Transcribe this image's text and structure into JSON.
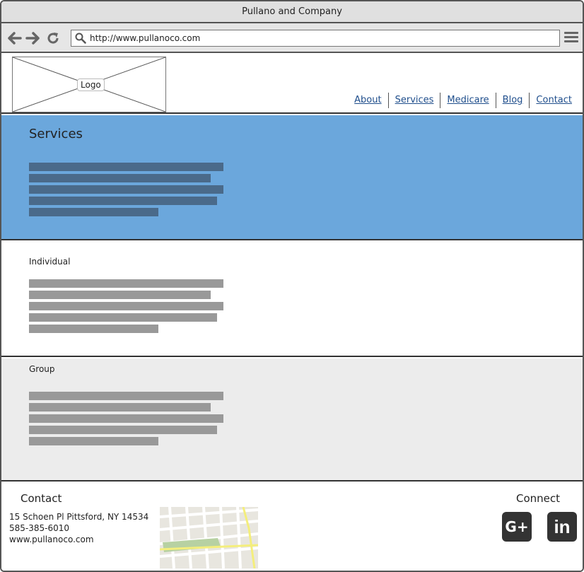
{
  "browser": {
    "window_title": "Pullano and Company",
    "url": "http://www.pullanoco.com",
    "icons": [
      "back-arrow-icon",
      "forward-arrow-icon",
      "reload-icon",
      "search-icon",
      "hamburger-menu-icon"
    ]
  },
  "header": {
    "logo_label": "Logo",
    "nav": [
      {
        "label": "About"
      },
      {
        "label": "Services"
      },
      {
        "label": "Medicare"
      },
      {
        "label": "Blog"
      },
      {
        "label": "Contact"
      }
    ]
  },
  "services": {
    "title": "Services",
    "color": "#6ba7dc"
  },
  "individual": {
    "title": "Individual"
  },
  "group": {
    "title": "Group"
  },
  "footer": {
    "contact_title": "Contact",
    "address": "15 Schoen Pl Pittsford, NY 14534",
    "phone": "585-385-6010",
    "website": "www.pullanoco.com",
    "connect_title": "Connect",
    "social": [
      {
        "label": "G+",
        "icon": "google-plus-icon"
      },
      {
        "label": "in",
        "icon": "linkedin-icon"
      }
    ]
  },
  "colors": {
    "link": "#1f4e8c",
    "services_band": "#6ba7dc",
    "group_band": "#ececec",
    "social_bg": "#333333"
  }
}
